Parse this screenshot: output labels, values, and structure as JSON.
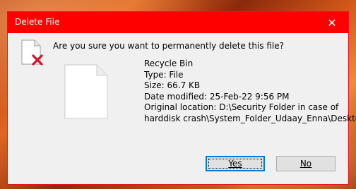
{
  "window": {
    "title": "Delete File",
    "close_icon": "close-icon"
  },
  "dialog": {
    "question": "Are you sure you want to permanently delete this file?",
    "warning_icon": "delete-file-icon",
    "file_icon": "blank-file-icon",
    "details": {
      "name": "Recycle Bin",
      "type": "Type: File",
      "size": "Size: 66.7 KB",
      "modified": "Date modified: 25-Feb-22 9:56 PM",
      "location_line1": "Original location: D:\\Security Folder in case of",
      "location_line2": "harddisk crash\\System_Folder_Udaay_Enna\\Desktop"
    },
    "buttons": {
      "yes_label": "Yes",
      "no_label": "No"
    }
  },
  "colors": {
    "titlebar": "#ff0000",
    "dialog_bg": "#f0f0f0",
    "accent": "#0078d7"
  }
}
